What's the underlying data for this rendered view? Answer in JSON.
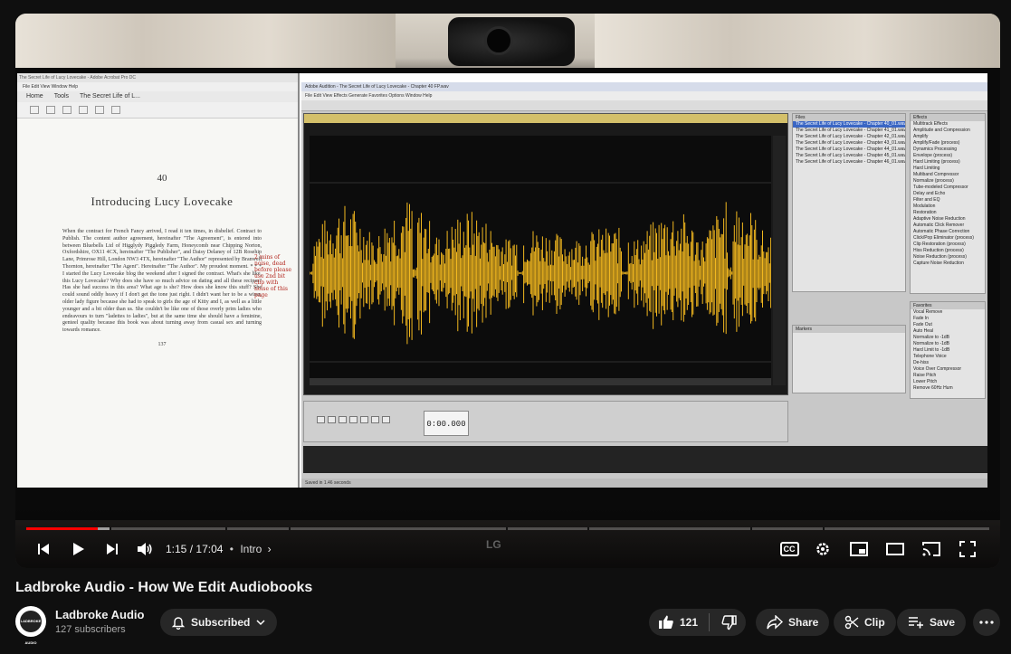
{
  "video": {
    "title": "Ladbroke Audio - How We Edit Audiobooks",
    "current_time": "1:15",
    "duration": "17:04",
    "time_separator": "/",
    "chapter": "Intro",
    "progress_fraction": 0.074,
    "buffered_fraction": 0.088
  },
  "screen": {
    "pdf_window_title": "The Secret Life of Lucy Lovecake - Adobe Acrobat Pro DC",
    "pdf_menu": "File  Edit  View  Window  Help",
    "pdf_tabs": [
      "Home",
      "Tools",
      "The Secret Life of L..."
    ],
    "page_number": "40",
    "page_title": "Introducing Lucy Lovecake",
    "page_text": "When the contract for French Fancy arrived, I read it ten times, in disbelief. Contract to Publish. The content author agreement, hereinafter \"The Agreement\", is entered into between Bluebells Ltd of Higglydy Piggledy Farm, Honeycomb near Chipping Norton, Oxfordshire, OX11 4CX, hereinafter \"The Publisher\", and Daisy Delaney of 12B Rosehip Lane, Primrose Hill, London NW3 4TX, hereinafter \"The Author\" represented by Branwell Thornton, hereinafter \"The Agent\". Hereinafter \"The Author\". My proudest moment. * * * I started the Lucy Lovecake blog the weekend after I signed the contract. What's she like, this Lucy Lovecake? Why does she have so much advice on dating and all these recipes? Has she had success in this area? What age is she? How does she know this stuff? She could sound oddly heavy if I don't get the tone just right. I didn't want her to be a wiser, older lady figure because she had to speak to girls the age of Kitty and I, as well as a little younger and a bit older than us. She couldn't be like one of those overly prim ladies who endeavours to turn \"ladettes to ladies\", but at the same time she should have a feminine, genteel quality because this book was about turning away from casual sex and turning towards romance.",
    "page_footer": "137",
    "margin_note": "2 mins of noise, dead before please use 2nd bit clip with noise of this page",
    "audition_title": "Adobe Audition - The Secret Life of Lucy Lovecake - Chapter 40 FP.wav",
    "audition_menu": "File  Edit  View  Effects  Generate  Favorites  Options  Window  Help",
    "time_display": "0:00.000",
    "files": [
      "The Secret Life of Lucy Lovecake - Chapter 40_01.wav",
      "The Secret Life of Lucy Lovecake - Chapter 41_01.wav",
      "The Secret Life of Lucy Lovecake - Chapter 42_01.wav",
      "The Secret Life of Lucy Lovecake - Chapter 43_01.wav",
      "The Secret Life of Lucy Lovecake - Chapter 44_01.wav",
      "The Secret Life of Lucy Lovecake - Chapter 45_01.wav",
      "The Secret Life of Lucy Lovecake - Chapter 46_01.wav"
    ],
    "effects": [
      "Multitrack Effects",
      "Amplitude and Compression",
      "Amplify",
      "Amplify/Fade (process)",
      "Dynamics Processing",
      "Envelope (process)",
      "Hard Limiting (process)",
      "Hard Limiting",
      "Multiband Compressor",
      "Normalize (process)",
      "Tube-modeled Compressor",
      "Delay and Echo",
      "Filter and EQ",
      "Modulation",
      "Restoration",
      "Adaptive Noise Reduction",
      "Automatic Click Remover",
      "Automatic Phase Correction",
      "Click/Pop Eliminator (process)",
      "Clip Restoration (process)",
      "Hiss Reduction (process)",
      "Noise Reduction (process)",
      "Capture Noise Reduction"
    ],
    "favorites": [
      "Vocal Remove",
      "Fade In",
      "Fade Out",
      "Auto Heal",
      "Normalize to -1dB",
      "Normalize to -1dB",
      "Hard Limit to -1dB",
      "Telephone Voice",
      "De-hiss",
      "Voice Over Compressor",
      "Raise Pitch",
      "Lower Pitch",
      "Remove 60Hz Hum"
    ],
    "status": "Saved in 1.46 seconds",
    "monitor_brand": "LG"
  },
  "controls": {
    "prev_icon": "skip-previous-icon",
    "play_icon": "play-icon",
    "next_icon": "skip-next-icon",
    "volume_icon": "volume-icon",
    "cc_label": "CC",
    "settings_icon": "gear-icon",
    "miniplayer_icon": "miniplayer-icon",
    "theater_icon": "theater-icon",
    "cast_icon": "cast-icon",
    "fullscreen_icon": "fullscreen-icon"
  },
  "channel": {
    "name": "Ladbroke Audio",
    "subscribers": "127 subscribers",
    "avatar_text": "LADBROKE AUDIO",
    "subscribe_label": "Subscribed"
  },
  "actions": {
    "like_count": "121",
    "share_label": "Share",
    "clip_label": "Clip",
    "save_label": "Save"
  },
  "colors": {
    "waveform": "#f2b81f",
    "progress": "#ff0000",
    "background": "#0f0f0f",
    "pill": "#272727"
  }
}
